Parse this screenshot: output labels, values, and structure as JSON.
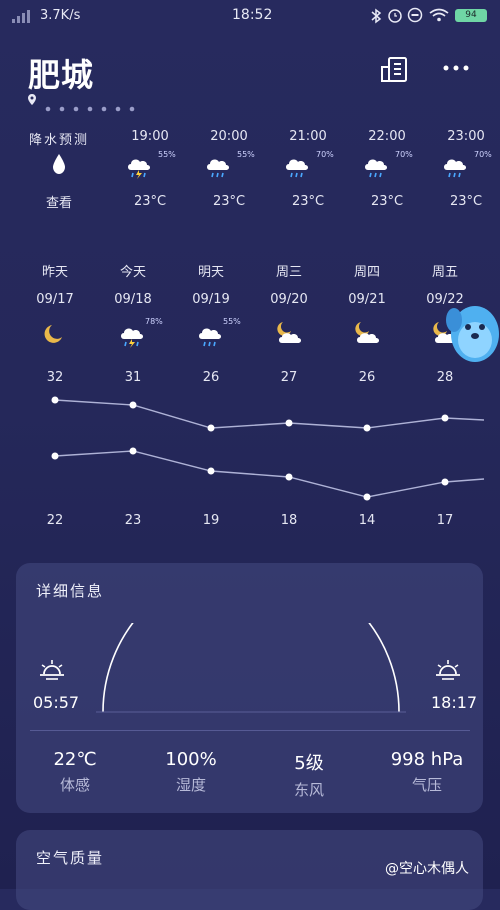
{
  "status_bar": {
    "speed": "3.7K/s",
    "time": "18:52",
    "battery": "94"
  },
  "header": {
    "city": "肥城"
  },
  "hourly": {
    "precip_label": "降水预测",
    "precip_action": "查看",
    "hours": [
      {
        "time": "19:00",
        "temp": "23°C",
        "pct": "55%",
        "icon": "thunder-rain-icon"
      },
      {
        "time": "20:00",
        "temp": "23°C",
        "pct": "55%",
        "icon": "rain-cloud-icon"
      },
      {
        "time": "21:00",
        "temp": "23°C",
        "pct": "70%",
        "icon": "rain-cloud-icon"
      },
      {
        "time": "22:00",
        "temp": "23°C",
        "pct": "70%",
        "icon": "rain-cloud-icon"
      },
      {
        "time": "23:00",
        "temp": "23°C",
        "pct": "70%",
        "icon": "rain-cloud-icon"
      }
    ]
  },
  "daily": [
    {
      "day": "昨天",
      "date": "09/17",
      "high": "32",
      "low": "22",
      "icon": "moon-icon"
    },
    {
      "day": "今天",
      "date": "09/18",
      "high": "31",
      "low": "23",
      "icon": "thunder-rain-icon",
      "pct": "78%"
    },
    {
      "day": "明天",
      "date": "09/19",
      "high": "26",
      "low": "19",
      "icon": "rain-cloud-icon",
      "pct": "55%"
    },
    {
      "day": "周三",
      "date": "09/20",
      "high": "27",
      "low": "18",
      "icon": "moon-cloud-icon"
    },
    {
      "day": "周四",
      "date": "09/21",
      "high": "26",
      "low": "14",
      "icon": "moon-cloud-icon"
    },
    {
      "day": "周五",
      "date": "09/22",
      "high": "28",
      "low": "17",
      "icon": "moon-cloud-icon"
    }
  ],
  "details": {
    "title": "详细信息",
    "sunrise": "05:57",
    "sunset": "18:17",
    "stats": [
      {
        "value": "22℃",
        "label": "体感"
      },
      {
        "value": "100%",
        "label": "湿度"
      },
      {
        "value": "5级",
        "label": "东风"
      },
      {
        "value": "998 hPa",
        "label": "气压"
      }
    ]
  },
  "air_quality": {
    "title": "空气质量"
  },
  "watermark": "@空心木偶人"
}
